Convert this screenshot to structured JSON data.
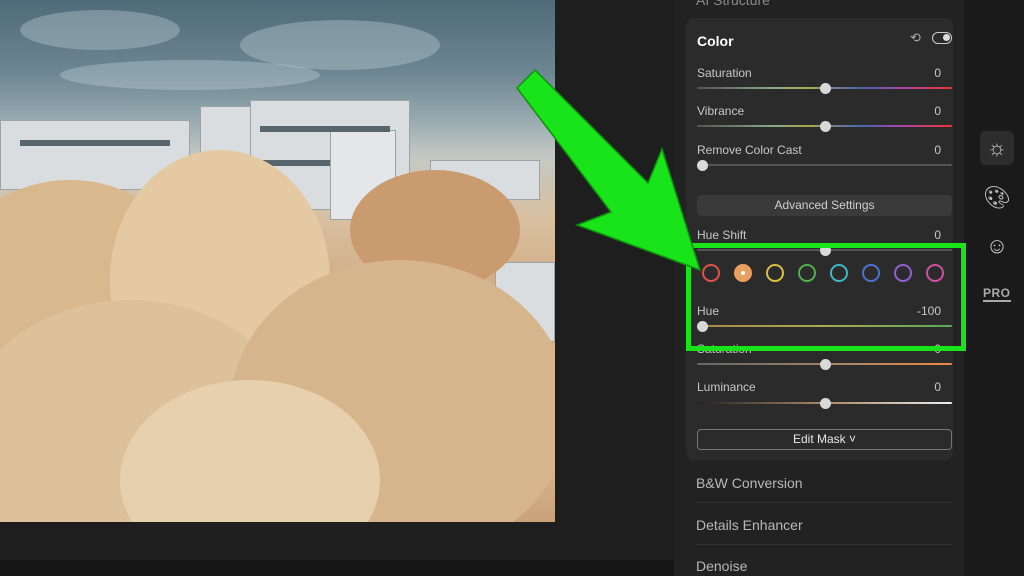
{
  "panel": {
    "previous_section": "AI Structure",
    "color_card": {
      "title": "Color",
      "saturation": {
        "label": "Saturation",
        "value": "0"
      },
      "vibrance": {
        "label": "Vibrance",
        "value": "0"
      },
      "remove_cast": {
        "label": "Remove Color Cast",
        "value": "0"
      },
      "advanced_label": "Advanced Settings",
      "hue_shift": {
        "label": "Hue Shift",
        "value": "0"
      },
      "hue": {
        "label": "Hue",
        "value": "-100"
      },
      "saturation_adv": {
        "label": "Saturation",
        "value": "0"
      },
      "luminance": {
        "label": "Luminance",
        "value": "0"
      },
      "edit_mask_label": "Edit Mask ˅"
    },
    "sections": [
      "B&W Conversion",
      "Details Enhancer",
      "Denoise"
    ]
  },
  "swatch_colors": [
    "#e05050",
    "#e8a060",
    "#d8c040",
    "#50b050",
    "#40b8c0",
    "#5070d0",
    "#9060d0",
    "#d050a0"
  ],
  "selected_swatch": 1,
  "toolbar": {
    "icons": [
      "sun-icon",
      "palette-icon",
      "smiley-icon"
    ],
    "pro_label": "PRO"
  },
  "annotation_color": "#19e319"
}
